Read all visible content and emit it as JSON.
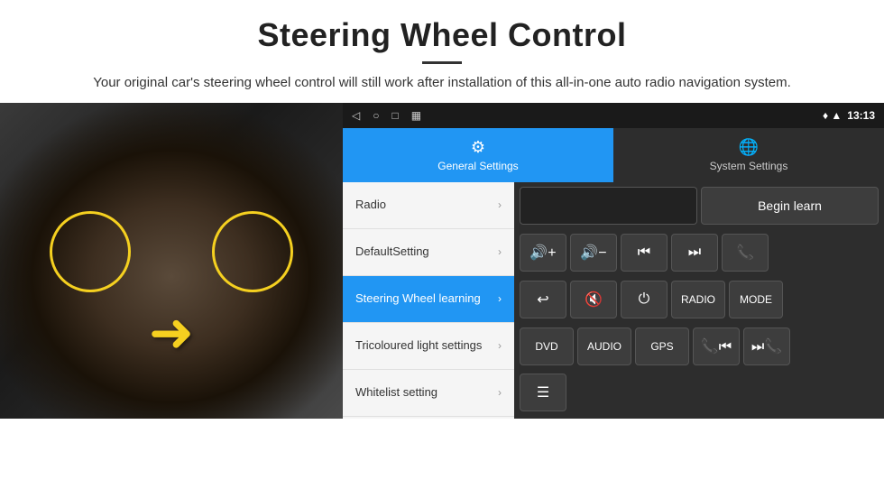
{
  "header": {
    "title": "Steering Wheel Control",
    "divider": true,
    "subtitle": "Your original car's steering wheel control will still work after installation of this all-in-one auto radio navigation system."
  },
  "status_bar": {
    "nav_icons": [
      "◁",
      "○",
      "□",
      "▦"
    ],
    "right": "13:13",
    "signal_icon": "▼",
    "wifi_icon": "▲"
  },
  "tabs": [
    {
      "label": "General Settings",
      "icon": "⚙",
      "active": true
    },
    {
      "label": "System Settings",
      "icon": "🌐",
      "active": false
    }
  ],
  "menu": [
    {
      "label": "Radio",
      "active": false
    },
    {
      "label": "DefaultSetting",
      "active": false
    },
    {
      "label": "Steering Wheel learning",
      "active": true
    },
    {
      "label": "Tricoloured light settings",
      "active": false
    },
    {
      "label": "Whitelist setting",
      "active": false
    }
  ],
  "controls": {
    "begin_learn": "Begin learn",
    "buttons": [
      [
        "🔊+",
        "🔊−",
        "⏮",
        "⏭",
        "📞"
      ],
      [
        "↩",
        "🔊✕",
        "⏻",
        "RADIO",
        "MODE"
      ],
      [
        "DVD",
        "AUDIO",
        "GPS",
        "📞⏮",
        "⏭📞"
      ],
      [
        "≡"
      ]
    ]
  }
}
